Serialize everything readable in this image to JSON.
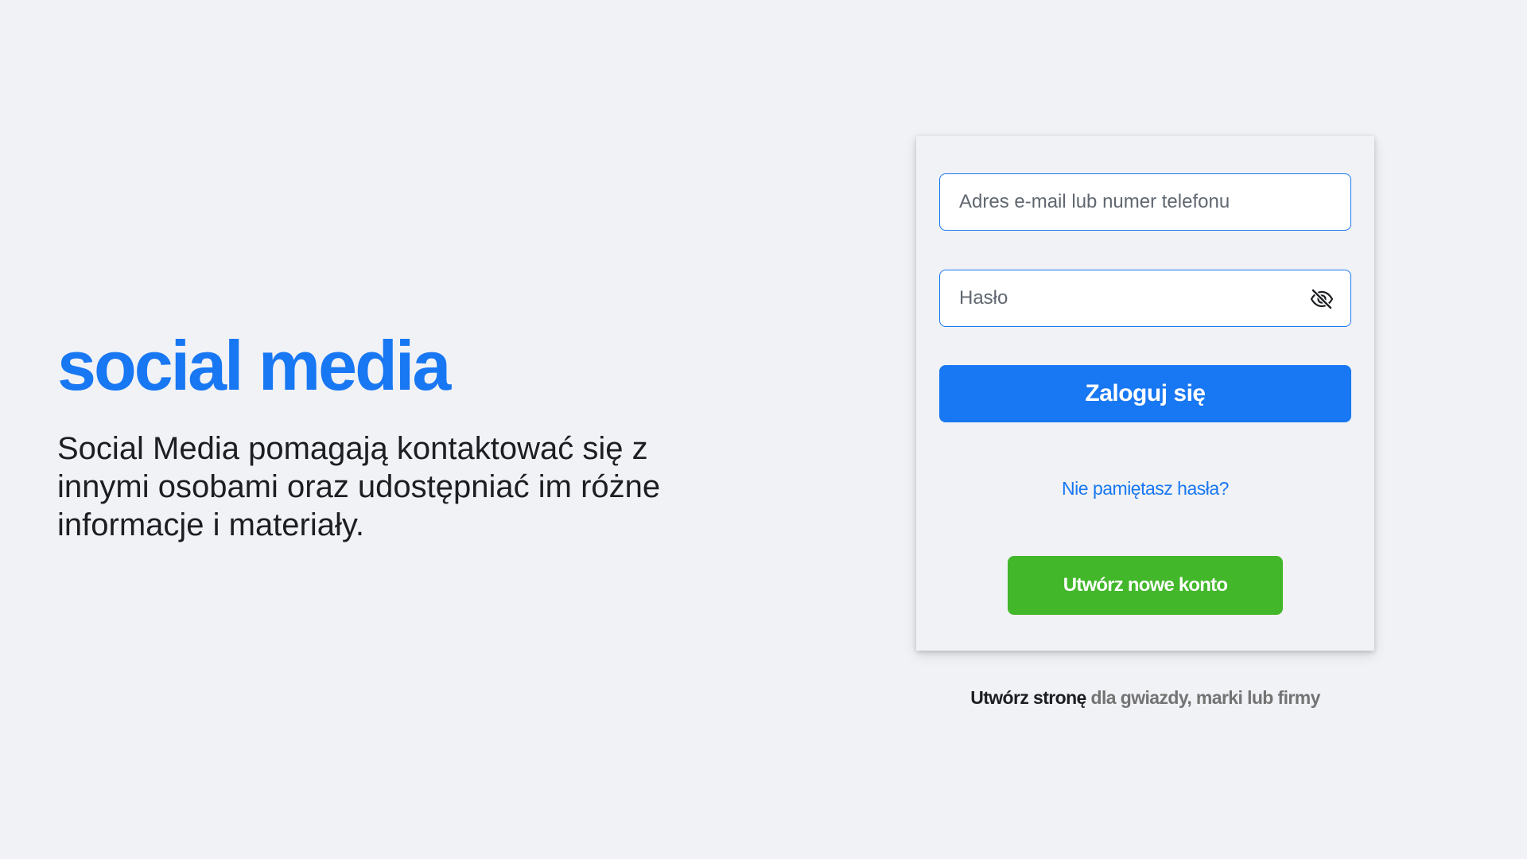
{
  "brand": {
    "logo_text": "social media",
    "tagline": "Social Media pomagają kontaktować się z innymi osobami oraz udostępniać im różne informacje i materiały."
  },
  "login_form": {
    "email_placeholder": "Adres e-mail lub numer telefonu",
    "email_value": "",
    "password_placeholder": "Hasło",
    "password_value": "",
    "password_toggle_icon": "eye-slash-icon",
    "login_button_label": "Zaloguj się",
    "forgot_password_link": "Nie pamiętasz hasła?",
    "create_account_button_label": "Utwórz nowe konto"
  },
  "footer": {
    "create_page_link": "Utwórz stronę",
    "create_page_rest": "dla gwiazdy, marki lub firmy"
  },
  "colors": {
    "background": "#f0f2f5",
    "primary_blue": "#1877f2",
    "create_green": "#42b72a",
    "text_dark": "#1c1e21",
    "text_gray": "#737373"
  }
}
